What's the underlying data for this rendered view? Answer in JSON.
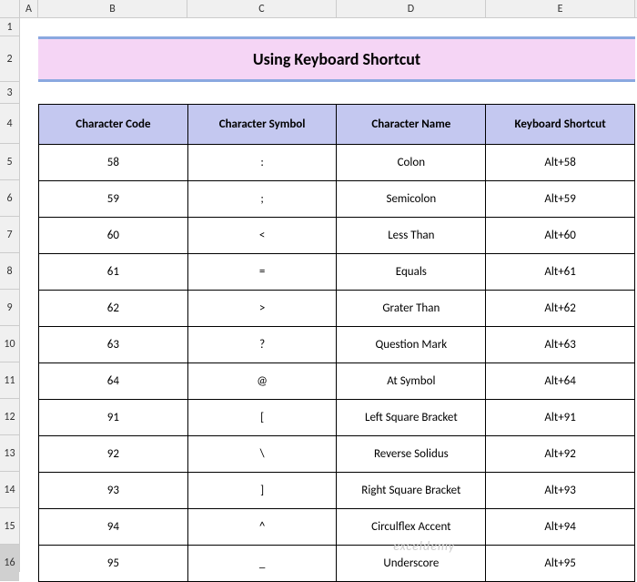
{
  "columns": [
    "A",
    "B",
    "C",
    "D",
    "E"
  ],
  "rows": [
    "1",
    "2",
    "3",
    "4",
    "5",
    "6",
    "7",
    "8",
    "9",
    "10",
    "11",
    "12",
    "13",
    "14",
    "15",
    "16"
  ],
  "title": "Using Keyboard Shortcut",
  "headers": {
    "code": "Character Code",
    "symbol": "Character Symbol",
    "name": "Character Name",
    "shortcut": "Keyboard Shortcut"
  },
  "watermark": "exceldemy",
  "chart_data": {
    "type": "table",
    "title": "Using Keyboard Shortcut",
    "columns": [
      "Character Code",
      "Character Symbol",
      "Character Name",
      "Keyboard Shortcut"
    ],
    "rows": [
      {
        "code": "58",
        "symbol": ":",
        "name": "Colon",
        "shortcut": "Alt+58"
      },
      {
        "code": "59",
        "symbol": ";",
        "name": "Semicolon",
        "shortcut": "Alt+59"
      },
      {
        "code": "60",
        "symbol": "<",
        "name": "Less Than",
        "shortcut": "Alt+60"
      },
      {
        "code": "61",
        "symbol": "=",
        "name": "Equals",
        "shortcut": "Alt+61"
      },
      {
        "code": "62",
        "symbol": ">",
        "name": "Grater Than",
        "shortcut": "Alt+62"
      },
      {
        "code": "63",
        "symbol": "?",
        "name": "Question Mark",
        "shortcut": "Alt+63"
      },
      {
        "code": "64",
        "symbol": "@",
        "name": "At Symbol",
        "shortcut": "Alt+64"
      },
      {
        "code": "91",
        "symbol": "[",
        "name": "Left Square Bracket",
        "shortcut": "Alt+91"
      },
      {
        "code": "92",
        "symbol": "\\",
        "name": "Reverse Solidus",
        "shortcut": "Alt+92"
      },
      {
        "code": "93",
        "symbol": "]",
        "name": "Right Square Bracket",
        "shortcut": "Alt+93"
      },
      {
        "code": "94",
        "symbol": "^",
        "name": "Circulflex Accent",
        "shortcut": "Alt+94"
      },
      {
        "code": "95",
        "symbol": "_",
        "name": "Underscore",
        "shortcut": "Alt+95"
      }
    ]
  }
}
